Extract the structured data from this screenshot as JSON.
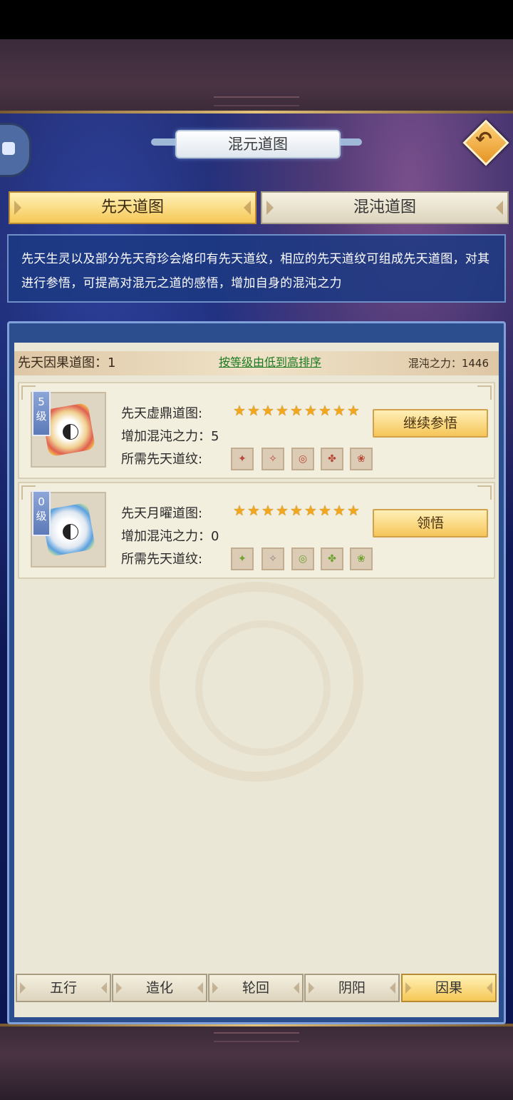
{
  "window": {
    "title": "混元道图"
  },
  "top_tabs": [
    {
      "label": "先天道图",
      "active": true
    },
    {
      "label": "混沌道图",
      "active": false
    }
  ],
  "description": "先天生灵以及部分先天奇珍会烙印有先天道纹，相应的先天道纹可组成先天道图，对其进行参悟，可提高对混元之道的感悟，增加自身的混沌之力",
  "header": {
    "count_label": "先天因果道图：1",
    "sort_link": "按等级由低到高排序",
    "power_label": "混沌之力：1446"
  },
  "cards": [
    {
      "level_number": "5",
      "level_unit": "级",
      "name_label": "先天虚鼎道图:",
      "stars": 9,
      "power_label": "增加混沌之力：5",
      "runes_label": "所需先天道纹:",
      "rune_icons": [
        "rune-red-icon",
        "rune-red-icon",
        "rune-red-icon",
        "rune-red-icon",
        "rune-red-icon"
      ],
      "action": "继续参悟"
    },
    {
      "level_number": "0",
      "level_unit": "级",
      "name_label": "先天月曜道图:",
      "stars": 9,
      "power_label": "增加混沌之力：0",
      "runes_label": "所需先天道纹:",
      "rune_icons": [
        "rune-green-icon",
        "rune-grey-icon",
        "rune-green-icon",
        "rune-green-icon",
        "rune-green-icon"
      ],
      "action": "领悟"
    }
  ],
  "bottom_tabs": [
    {
      "label": "五行",
      "active": false
    },
    {
      "label": "造化",
      "active": false
    },
    {
      "label": "轮回",
      "active": false
    },
    {
      "label": "阴阳",
      "active": false
    },
    {
      "label": "因果",
      "active": true
    }
  ],
  "colors": {
    "accent_gold": "#f6c856",
    "sort_link": "#1d7a22",
    "star": "#f2a71c"
  }
}
